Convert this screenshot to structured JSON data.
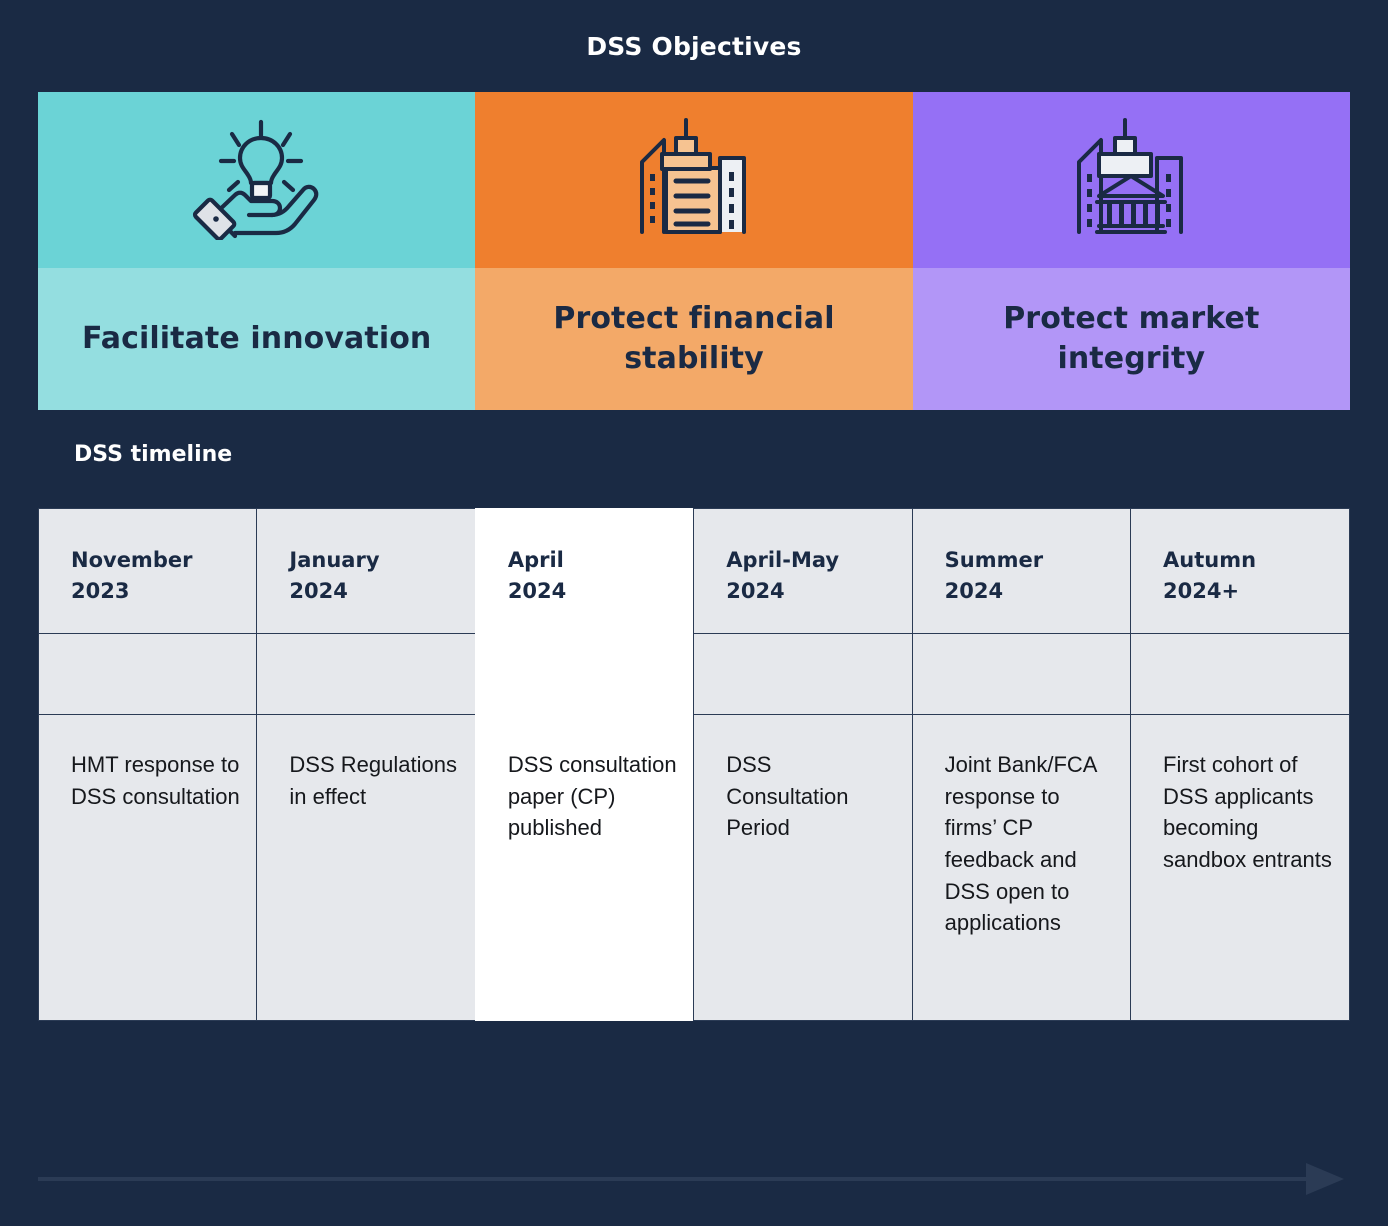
{
  "header": {
    "title": "DSS Objectives"
  },
  "objectives": {
    "cards": [
      {
        "label": "Facilitate innovation",
        "icon": "hand-holding-lightbulb-icon",
        "band_color": "#6bd3d6",
        "label_color": "#94dee0"
      },
      {
        "label": "Protect financial stability",
        "icon": "city-buildings-icon",
        "band_color": "#ef7f2e",
        "label_color": "#f3a968"
      },
      {
        "label": "Protect market integrity",
        "icon": "bank-institution-icon",
        "band_color": "#9570f5",
        "label_color": "#b296f7"
      }
    ]
  },
  "timeline": {
    "heading": "DSS timeline",
    "arrow_icon": "right-arrow-icon",
    "columns": [
      {
        "period": "November",
        "year": "2023",
        "description": "HMT response to DSS consultation",
        "highlighted": false
      },
      {
        "period": "January",
        "year": "2024",
        "description": "DSS Regulations in effect",
        "highlighted": false
      },
      {
        "period": "April",
        "year": "2024",
        "description": "DSS consultation paper (CP) published",
        "highlighted": true
      },
      {
        "period": "April-May",
        "year": "2024",
        "description": "DSS Consultation Period",
        "highlighted": false
      },
      {
        "period": "Summer",
        "year": "2024",
        "description": "Joint Bank/FCA response to firms’ CP feedback and DSS open to applications",
        "highlighted": false
      },
      {
        "period": "Autumn",
        "year": "2024+",
        "description": "First cohort of DSS applicants becoming sandbox entrants",
        "highlighted": false
      }
    ]
  },
  "colors": {
    "background": "#1a2a44",
    "cell": "#e6e8ec",
    "highlight_cell": "#ffffff",
    "ink": "#1a2a44",
    "border": "#2b3b55"
  }
}
